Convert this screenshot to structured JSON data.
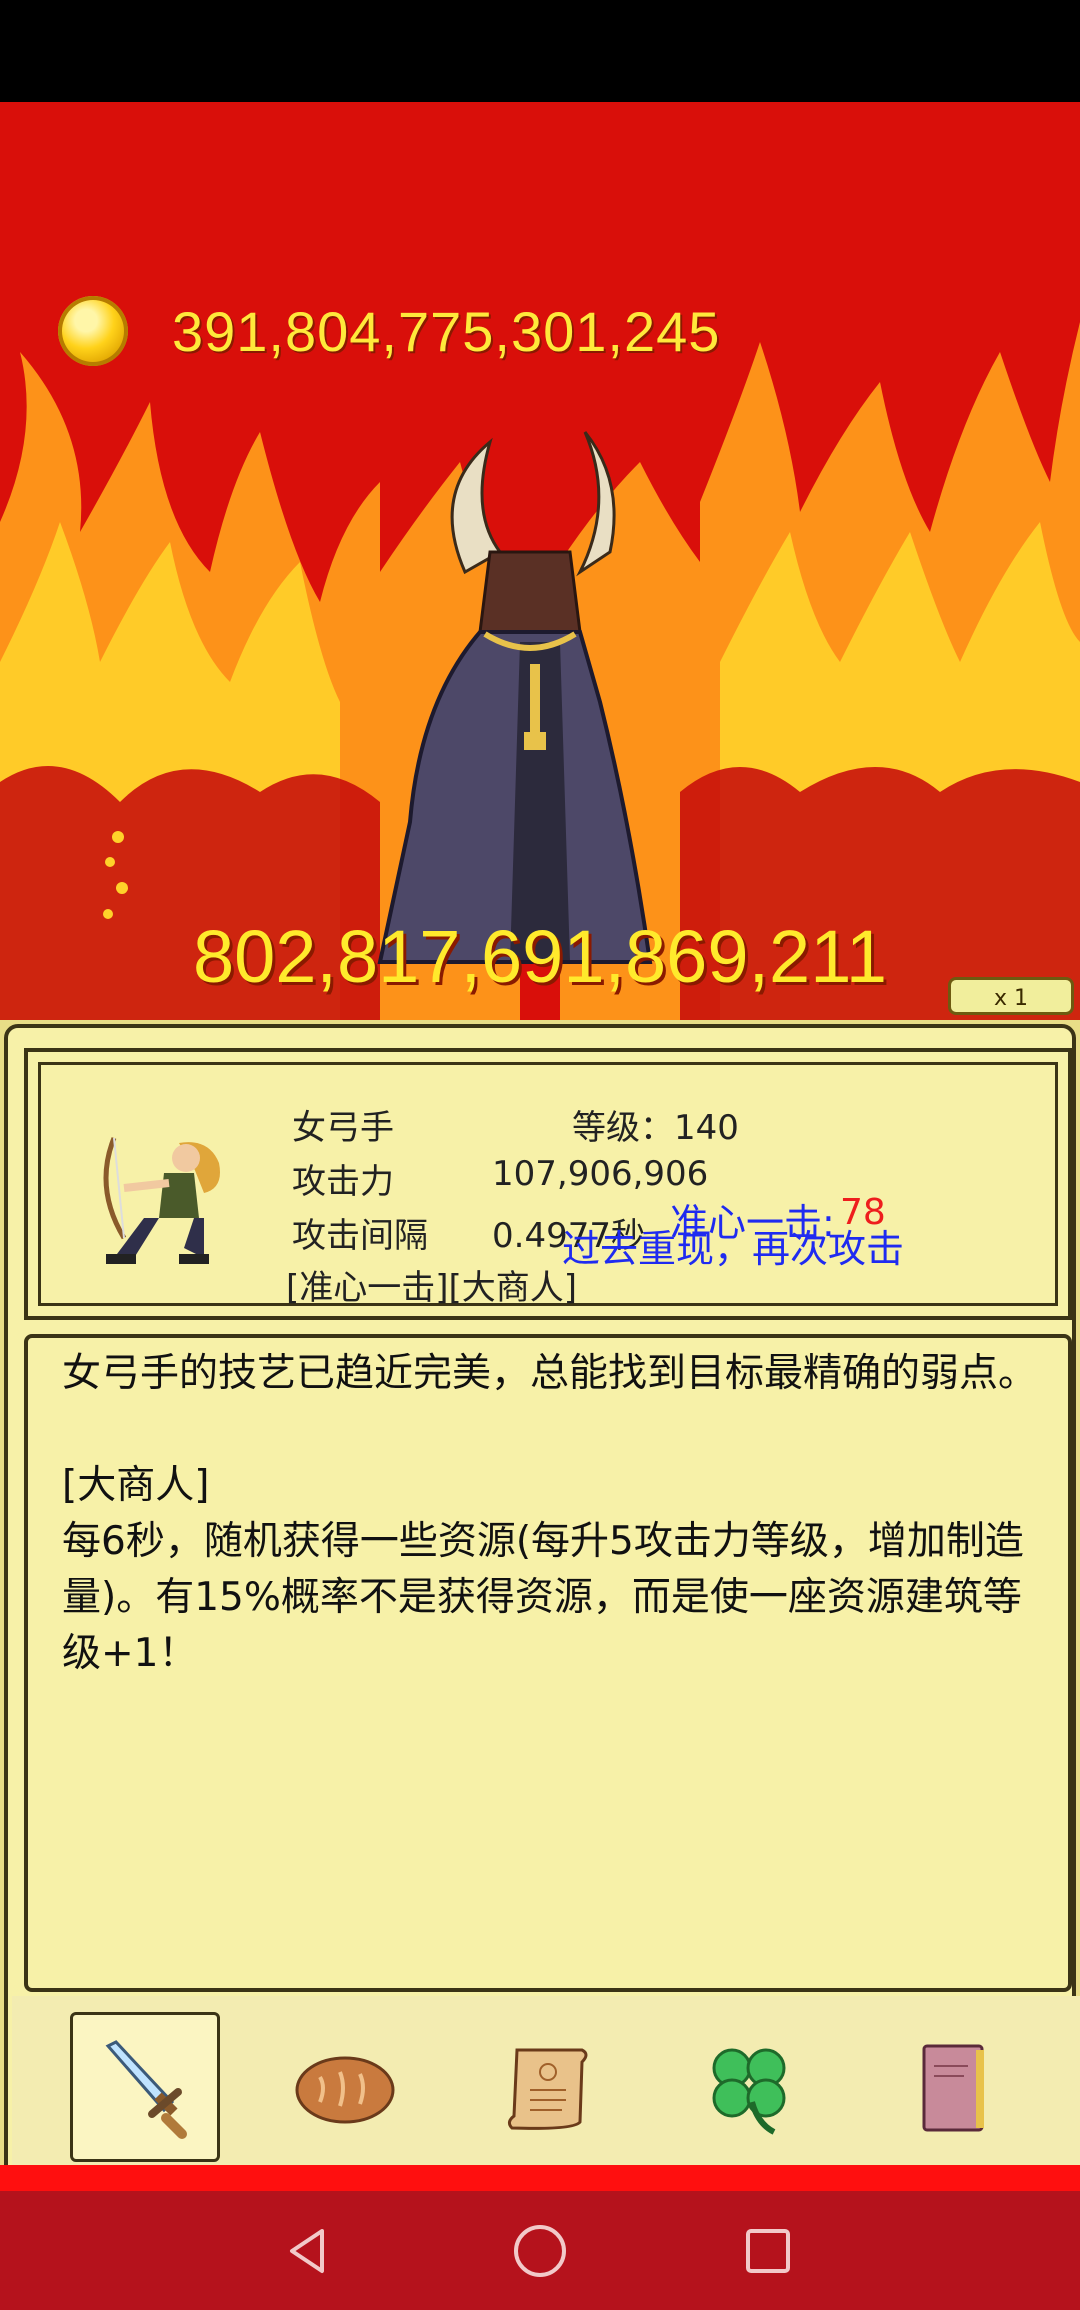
{
  "resources": {
    "gold": "391,804,775,301,245"
  },
  "boss": {
    "hp": "802,817,691,869,211"
  },
  "speed_badge": "x 1",
  "hero": {
    "name": "女弓手",
    "level_label": "等级：140",
    "attack_label": "攻击力",
    "attack_value": "107,906,906",
    "interval_label": "攻击间隔",
    "interval_value": "0.4977秒",
    "traits": "[准心一击][大商人]",
    "overlay_blue_1": "准心一击:",
    "overlay_red": "78",
    "overlay_blue_2": "过去重现，再次攻击"
  },
  "description": "女弓手的技艺已趋近完美，总能找到目标最精确的弱点。\n\n[大商人]\n每6秒，随机获得一些资源(每升5攻击力等级，增加制造量)。有15%概率不是获得资源，而是使一座资源建筑等级+1！",
  "tabs": [
    {
      "name": "sword-icon",
      "selected": true
    },
    {
      "name": "bread-icon",
      "selected": false
    },
    {
      "name": "scroll-icon",
      "selected": false
    },
    {
      "name": "clover-icon",
      "selected": false
    },
    {
      "name": "book-icon",
      "selected": false
    }
  ],
  "nav": [
    "back-icon",
    "home-icon",
    "recents-icon"
  ],
  "colors": {
    "background_red": "#d90f0a",
    "gold_text": "#ffe93b",
    "panel": "#f7f1a8",
    "blue_overlay": "#1f2bf0",
    "red_overlay": "#ee1d1d"
  }
}
